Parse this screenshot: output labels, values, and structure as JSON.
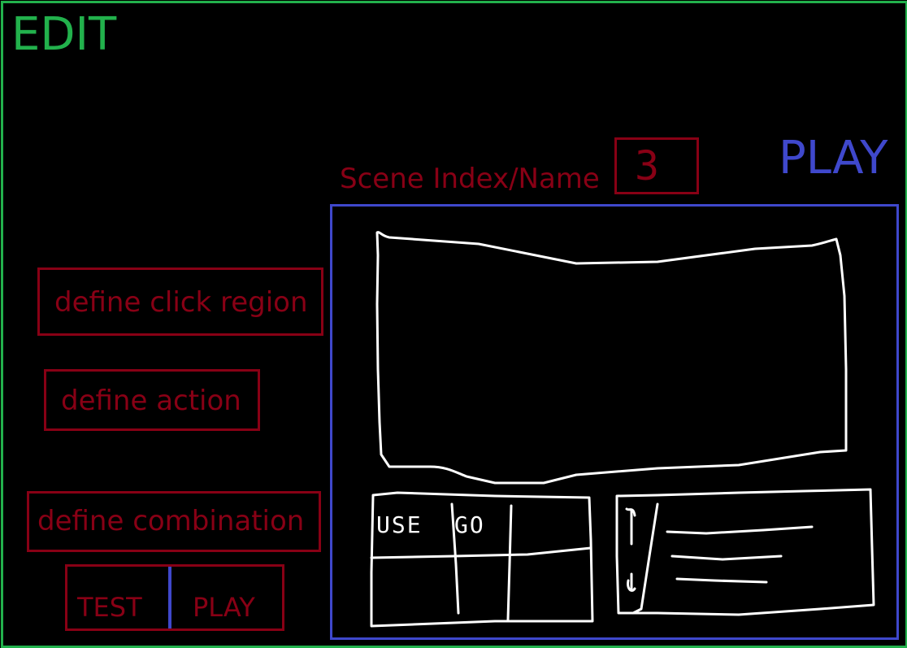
{
  "mode_label": "EDIT",
  "play_label": "PLAY",
  "scene": {
    "label": "Scene Index/Name",
    "value": "3"
  },
  "buttons": {
    "define_click_region": "define click region",
    "define_action": "define action",
    "define_combination": "define combination"
  },
  "toggle": {
    "test": "TEST",
    "play": "PLAY"
  },
  "commands": {
    "use": "USE",
    "go": "GO"
  },
  "colors": {
    "edit_green": "#22b14c",
    "play_blue": "#3f48cc",
    "control_red": "#880015",
    "sketch_white": "#ffffff",
    "background": "#000000"
  }
}
